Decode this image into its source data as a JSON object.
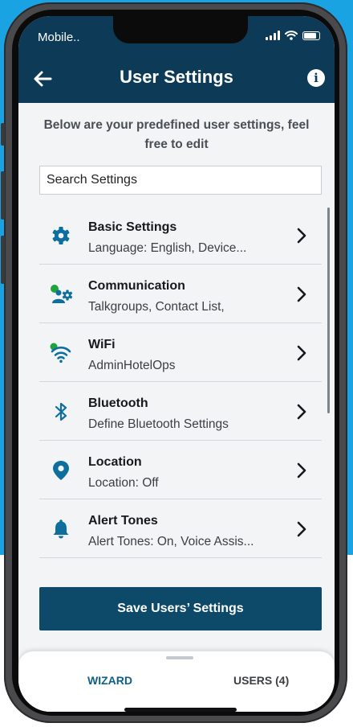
{
  "status_bar": {
    "carrier": "Mobile.."
  },
  "header": {
    "title": "User Settings"
  },
  "intro": "Below are your predefined user settings, feel free to edit",
  "search": {
    "placeholder": "Search Settings"
  },
  "settings": [
    {
      "label": "Basic Settings",
      "sub": "Language: English, Device...",
      "icon": "gear-icon"
    },
    {
      "label": "Communication",
      "sub": "Talkgroups, Contact List,",
      "icon": "communication-icon"
    },
    {
      "label": "WiFi",
      "sub": "AdminHotelOps",
      "icon": "wifi-icon"
    },
    {
      "label": "Bluetooth",
      "sub": "Define Bluetooth Settings",
      "icon": "bluetooth-icon"
    },
    {
      "label": "Location",
      "sub": "Location: Off",
      "icon": "location-pin-icon"
    },
    {
      "label": "Alert Tones",
      "sub": "Alert Tones: On, Voice Assis...",
      "icon": "bell-icon"
    }
  ],
  "save_button": "Save Users’ Settings",
  "bottom_nav": {
    "wizard": "WIZARD",
    "users": "USERS (4)"
  },
  "colors": {
    "header": "#0d3b57",
    "accent": "#0e6f9e",
    "status_green": "#1ea43a",
    "button": "#0d4a6a",
    "background_blue": "#1aa3e3"
  }
}
